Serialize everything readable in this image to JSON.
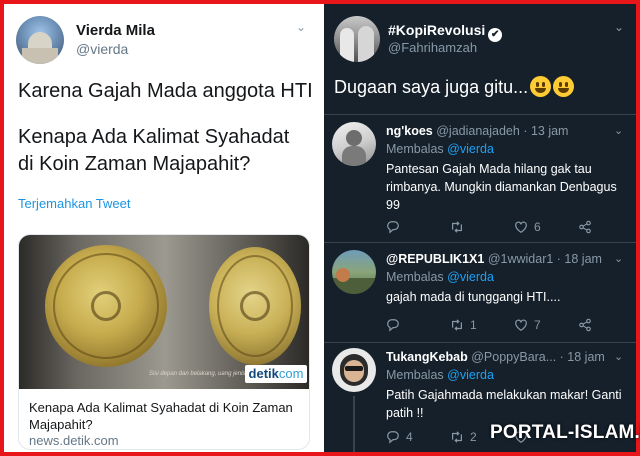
{
  "left_tweet": {
    "name": "Vierda Mila",
    "handle": "@vierda",
    "text_line1": "Karena Gajah Mada anggota HTI",
    "text_line2": "Kenapa Ada Kalimat Syahadat di Koin Zaman Majapahit?",
    "translate": "Terjemahkan Tweet",
    "card": {
      "image_caption": "Sisi depan dan belakang, uang jenis ini pernah beredar",
      "logo_main": "detik",
      "logo_sub": "com",
      "title": "Kenapa Ada Kalimat Syahadat di Koin Zaman Majapahit?",
      "domain": "news.detik.com"
    }
  },
  "right_tweet": {
    "name": "#KopiRevolusi",
    "verified_mark": "✔",
    "handle": "@Fahrihamzah",
    "text": "Dugaan saya juga gitu...",
    "replies": [
      {
        "name": "ng'koes",
        "handle": "@jadianajadeh",
        "time": "· 13 jam",
        "replying_prefix": "Membalas",
        "replying_to": "@vierda",
        "text": "Pantesan Gajah Mada hilang gak tau rimbanya. Mungkin diamankan Denbagus 99",
        "reply_count": "",
        "retweet_count": "",
        "like_count": "6"
      },
      {
        "name": "@REPUBLIK1X1",
        "handle": "@1wwidar1",
        "time": "· 18 jam",
        "replying_prefix": "Membalas",
        "replying_to": "@vierda",
        "text": "gajah mada di tunggangi HTI....",
        "reply_count": "",
        "retweet_count": "1",
        "like_count": "7"
      },
      {
        "name": "TukangKebab",
        "handle": "@PoppyBara...",
        "time": "· 18 jam",
        "replying_prefix": "Membalas",
        "replying_to": "@vierda",
        "text": "Patih Gajahmada melakukan makar! Ganti patih !!",
        "reply_count": "4",
        "retweet_count": "2",
        "like_count": ""
      }
    ]
  },
  "watermark": "PORTAL-ISLAM.ID",
  "colors": {
    "border": "#e8161b",
    "dark_bg": "#15202b",
    "link_blue": "#1da1f2",
    "muted": "#8899a6"
  }
}
